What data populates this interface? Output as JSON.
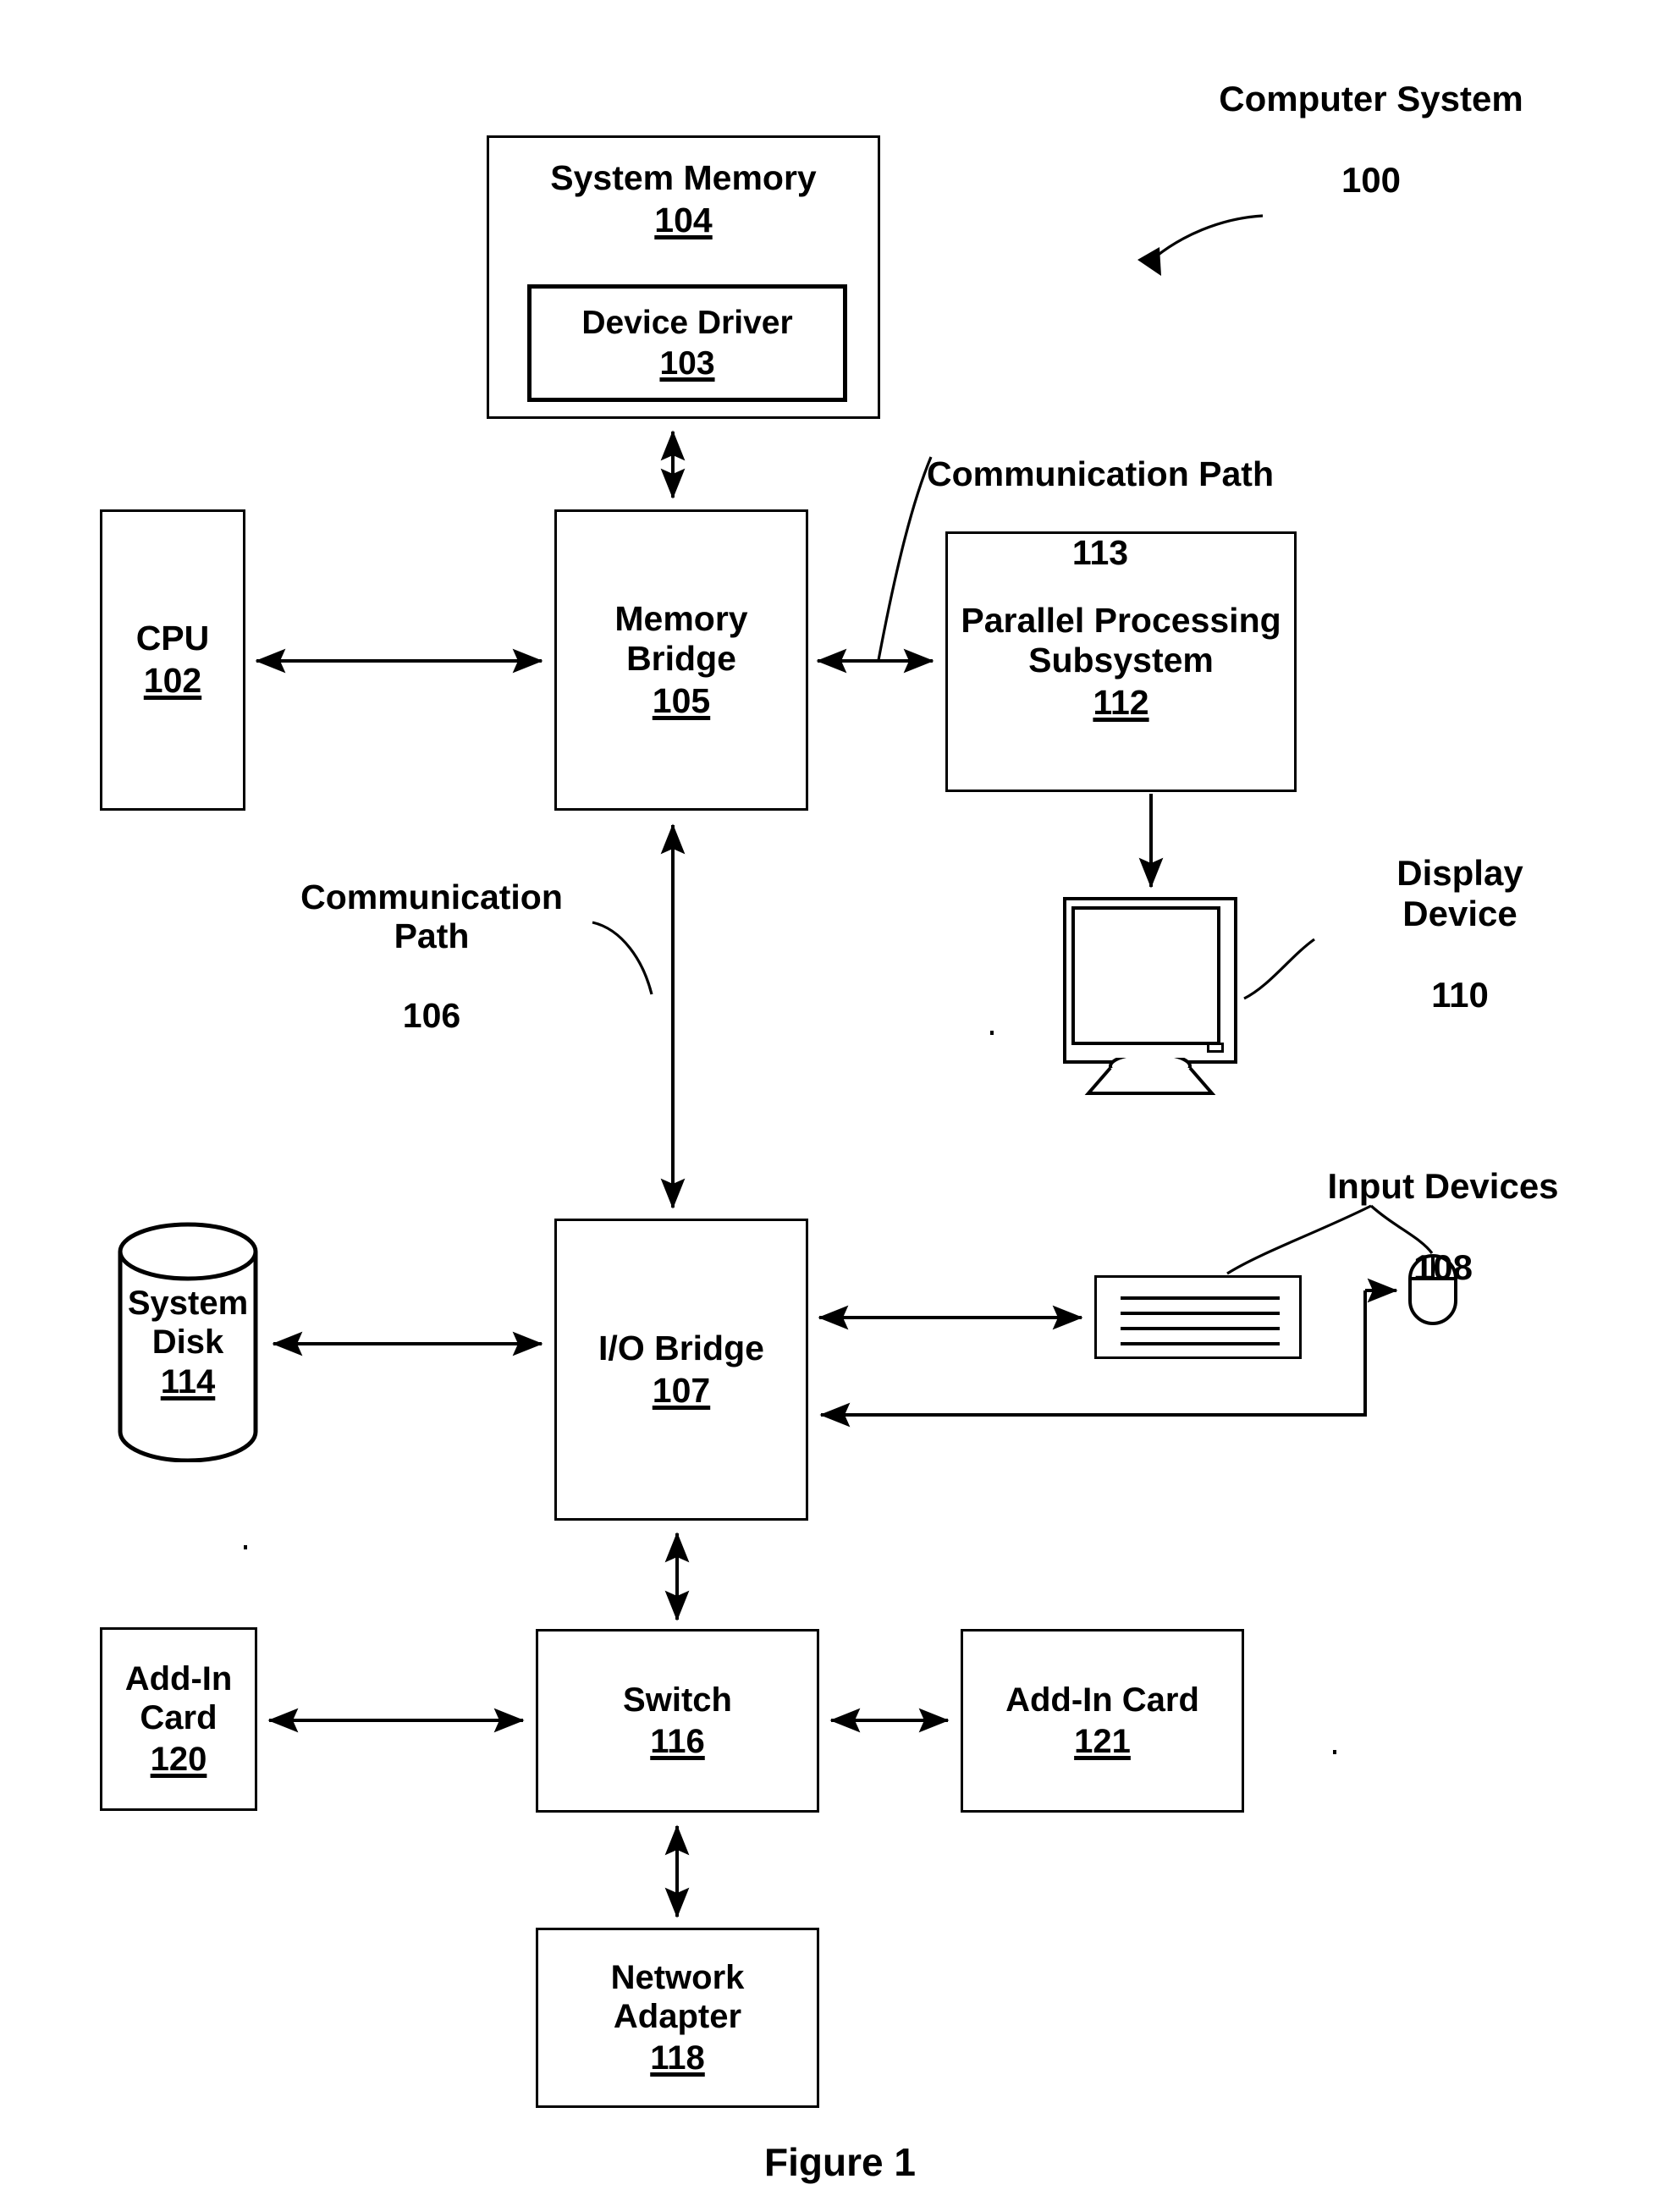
{
  "figure": {
    "caption": "Figure 1",
    "title_label": "Computer System",
    "title_ref": "100"
  },
  "nodes": {
    "system_memory": {
      "title": "System Memory",
      "ref": "104"
    },
    "device_driver": {
      "title": "Device Driver",
      "ref": "103"
    },
    "cpu": {
      "title": "CPU",
      "ref": "102"
    },
    "memory_bridge": {
      "title": "Memory\nBridge",
      "ref": "105"
    },
    "parallel_processing": {
      "title": "Parallel Processing\nSubsystem",
      "ref": "112"
    },
    "io_bridge": {
      "title": "I/O Bridge",
      "ref": "107"
    },
    "system_disk": {
      "title": "System\nDisk",
      "ref": "114"
    },
    "add_in_card_120": {
      "title": "Add-In Card",
      "ref": "120"
    },
    "switch": {
      "title": "Switch",
      "ref": "116"
    },
    "add_in_card_121": {
      "title": "Add-In Card",
      "ref": "121"
    },
    "network_adapter": {
      "title": "Network\nAdapter",
      "ref": "118"
    },
    "display_device": {
      "title": "Display\nDevice",
      "ref": "110"
    },
    "input_devices": {
      "title": "Input Devices",
      "ref": "108"
    }
  },
  "labels": {
    "communication_path_113": {
      "title": "Communication Path",
      "ref": "113"
    },
    "communication_path_106": {
      "title": "Communication\nPath",
      "ref": "106"
    }
  },
  "style": {
    "ink": "#000000",
    "paper": "#ffffff"
  },
  "connections": [
    {
      "from": "memory_bridge",
      "to": "system_memory",
      "kind": "bidirectional"
    },
    {
      "from": "cpu",
      "to": "memory_bridge",
      "kind": "bidirectional"
    },
    {
      "from": "memory_bridge",
      "to": "parallel_processing",
      "kind": "bidirectional",
      "label": "communication_path_113"
    },
    {
      "from": "parallel_processing",
      "to": "display_device",
      "kind": "unidirectional"
    },
    {
      "from": "memory_bridge",
      "to": "io_bridge",
      "kind": "bidirectional",
      "label": "communication_path_106"
    },
    {
      "from": "system_disk",
      "to": "io_bridge",
      "kind": "bidirectional"
    },
    {
      "from": "io_bridge",
      "to": "keyboard",
      "kind": "bidirectional"
    },
    {
      "from": "mouse",
      "to": "io_bridge",
      "kind": "unidirectional"
    },
    {
      "from": "io_bridge",
      "to": "switch",
      "kind": "bidirectional"
    },
    {
      "from": "add_in_card_120",
      "to": "switch",
      "kind": "bidirectional"
    },
    {
      "from": "switch",
      "to": "add_in_card_121",
      "kind": "bidirectional"
    },
    {
      "from": "switch",
      "to": "network_adapter",
      "kind": "bidirectional"
    }
  ]
}
